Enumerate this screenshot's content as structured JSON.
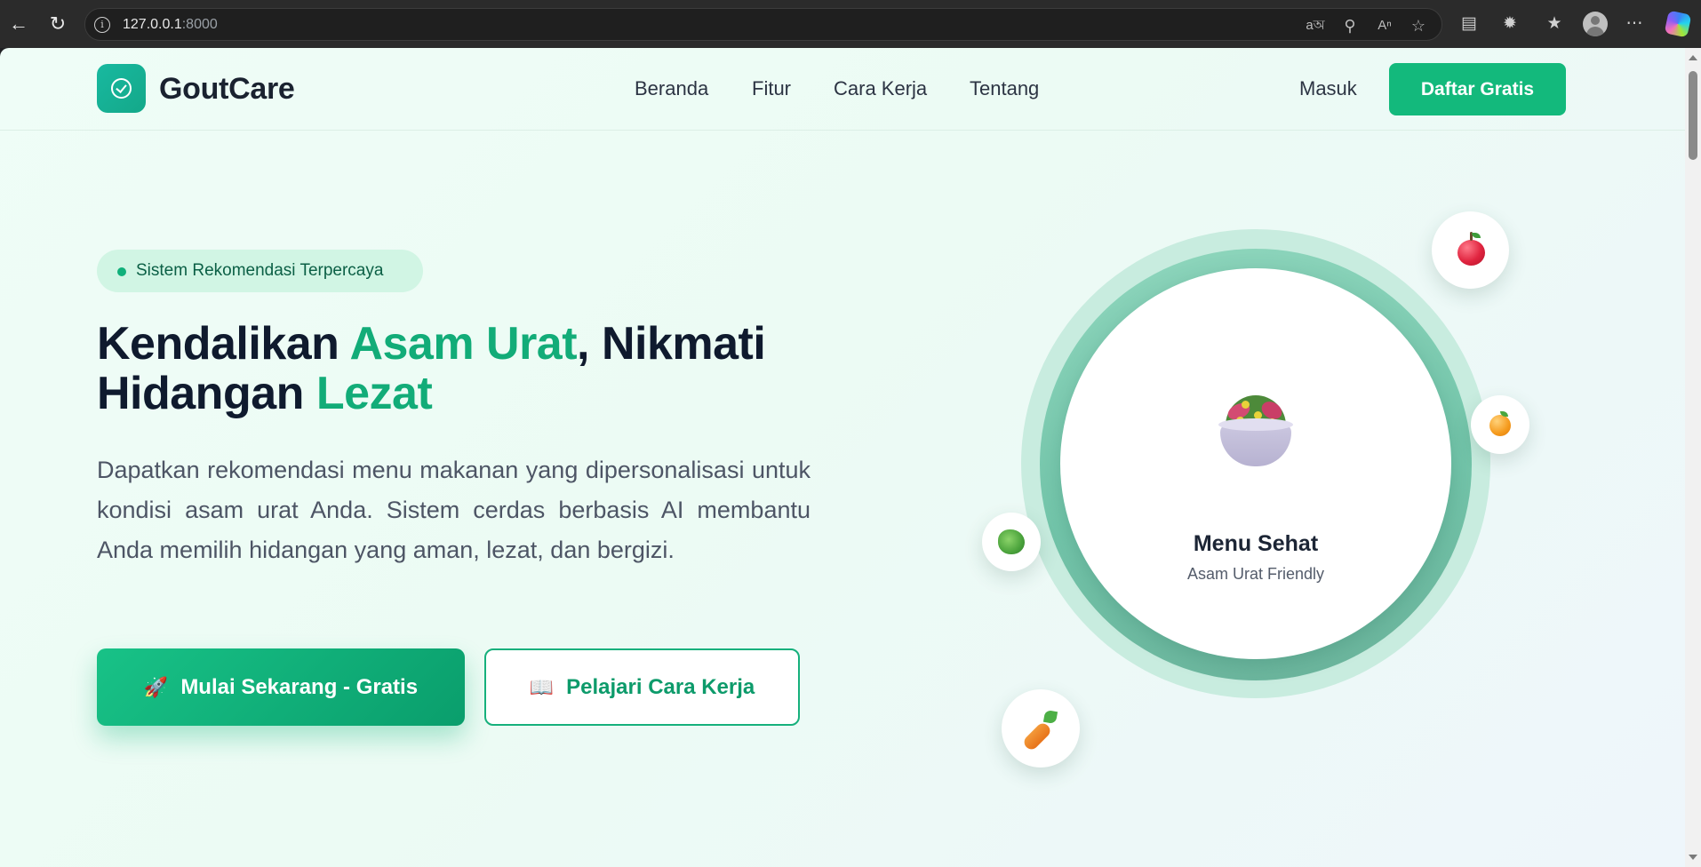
{
  "browser": {
    "url_host": "127.0.0.1",
    "url_port": ":8000",
    "icons": {
      "back": "back-arrow-icon",
      "reload": "reload-icon",
      "info": "site-info-icon",
      "translate": "translate-icon",
      "zoom": "zoom-icon",
      "read_aloud": "read-aloud-icon",
      "favorite": "star-icon",
      "reading_list": "reading-list-icon",
      "extensions": "puzzle-icon",
      "favorites_bar": "favorites-icon",
      "profile": "profile-icon",
      "menu": "more-icon",
      "copilot": "copilot-icon"
    }
  },
  "header": {
    "brand": "GoutCare",
    "nav": [
      "Beranda",
      "Fitur",
      "Cara Kerja",
      "Tentang"
    ],
    "login": "Masuk",
    "signup": "Daftar Gratis"
  },
  "hero": {
    "badge": "Sistem Rekomendasi Terpercaya",
    "headline": {
      "part1": "Kendalikan ",
      "accent1": "Asam Urat",
      "part2": ", Nikmati",
      "part3": "Hidangan ",
      "accent2": "Lezat"
    },
    "description": "Dapatkan rekomendasi menu makanan yang dipersonalisasi untuk kondisi asam urat Anda. Sistem cerdas berbasis AI membantu Anda memilih hidangan yang aman, lezat, dan bergizi.",
    "primary_cta": {
      "emoji": "🚀",
      "label": "Mulai Sekarang - Gratis"
    },
    "secondary_cta": {
      "emoji": "📖",
      "label": "Pelajari Cara Kerja"
    }
  },
  "showcase": {
    "title": "Menu Sehat",
    "subtitle": "Asam Urat Friendly",
    "center_icon": "salad-bowl-icon",
    "floating_icons": [
      "apple-icon",
      "orange-icon",
      "lettuce-icon",
      "carrot-icon"
    ]
  },
  "colors": {
    "brand_green": "#13b97c",
    "accent_text": "#12ac78",
    "logo_teal": "#18b9a0",
    "dark_text": "#0f1a2e"
  }
}
